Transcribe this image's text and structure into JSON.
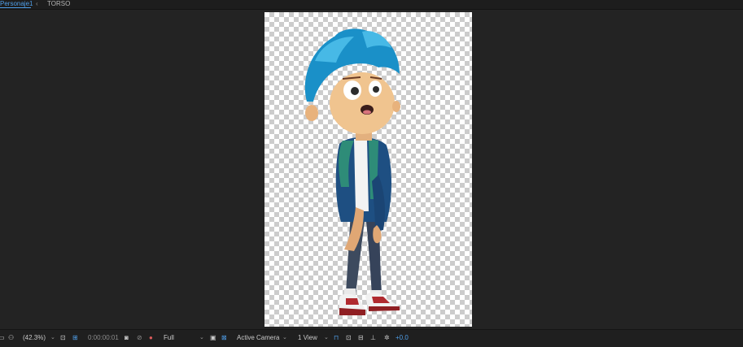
{
  "tabs": {
    "active_label": "Personaje1",
    "arrow_glyph": "‹",
    "second_label": "TORSO"
  },
  "viewer": {
    "content": "animated boy character on transparent checkerboard background",
    "colors": {
      "background": "#232323",
      "checker_light": "#ffffff",
      "checker_dark": "#cccccc",
      "accent": "#4f9ee8"
    }
  },
  "toolbar": {
    "zoom": "(42.3%)",
    "timecode": "0:00:00:01",
    "resolution": "Full",
    "camera": "Active Camera",
    "views": "1 View",
    "exposure": "+0.0",
    "chevron_glyph": "⌄"
  }
}
